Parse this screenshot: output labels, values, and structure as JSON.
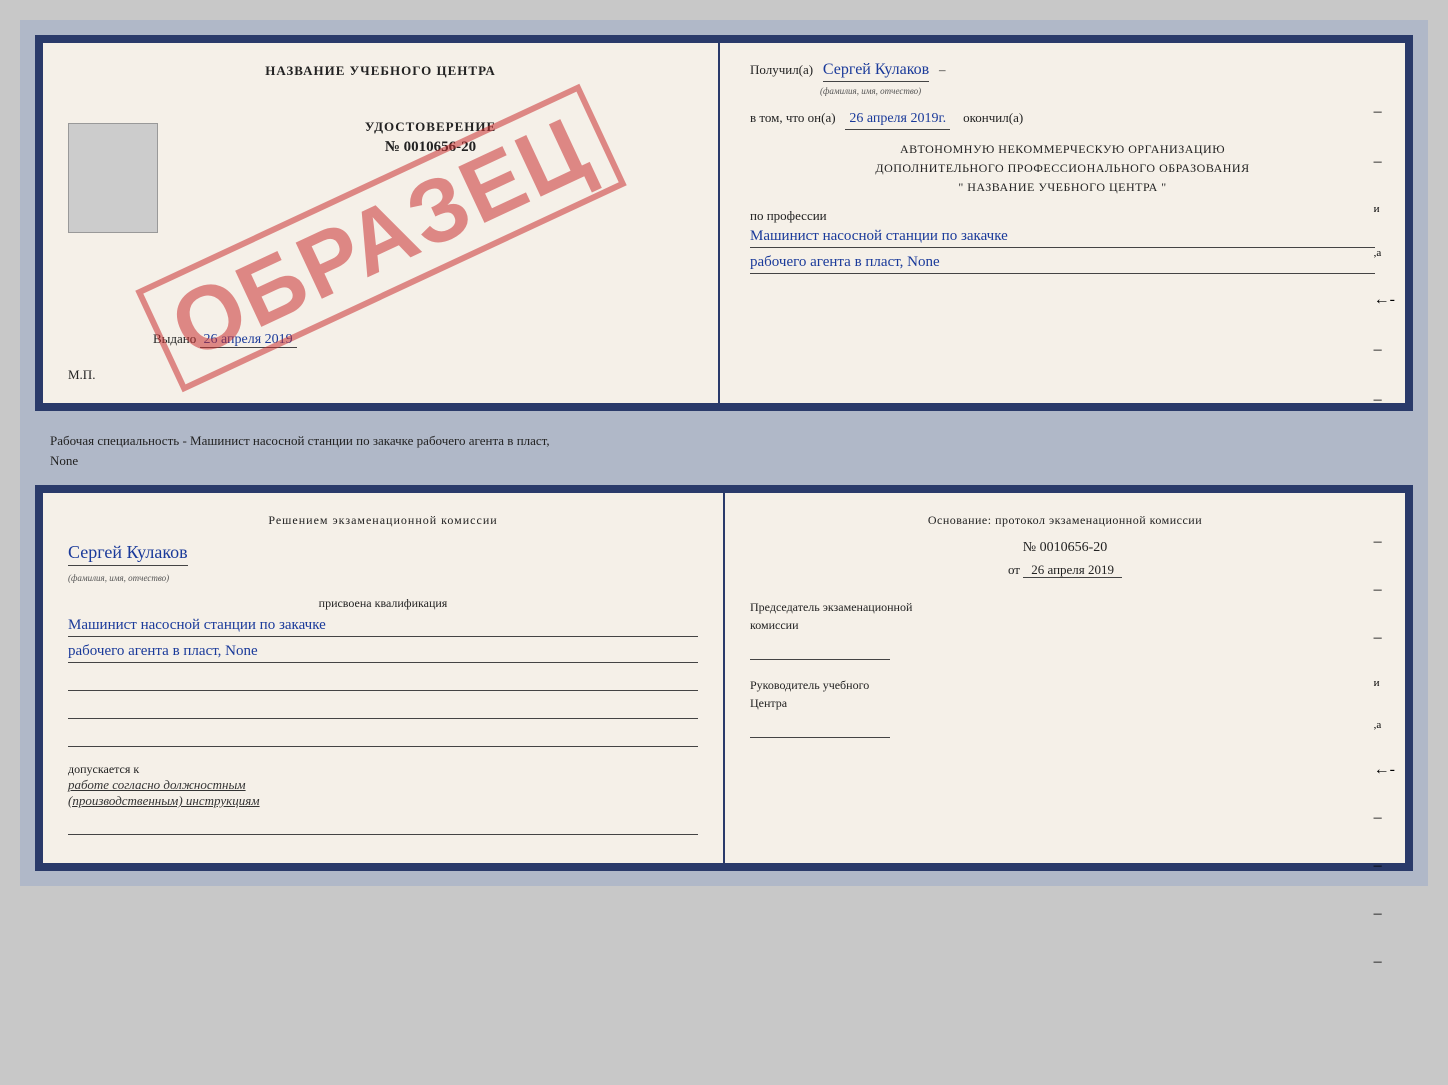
{
  "diploma": {
    "left": {
      "title": "НАЗВАНИЕ УЧЕБНОГО ЦЕНТРА",
      "photo_alt": "photo",
      "stamp_text": "ОБРАЗЕЦ",
      "udostoverenie_label": "УДОСТОВЕРЕНИЕ",
      "udostoverenie_number": "№ 0010656-20",
      "vydano_label": "Выдано",
      "vydano_date": "26 апреля 2019",
      "mp_label": "М.П."
    },
    "right": {
      "poluchil_label": "Получил(а)",
      "recipient_name": "Сергей Кулаков",
      "familiya_label": "(фамилия, имя, отчество)",
      "vtom_label": "в том, что он(а)",
      "completion_date": "26 апреля 2019г.",
      "okonchil_label": "окончил(а)",
      "org_line1": "АВТОНОМНУЮ НЕКОММЕРЧЕСКУЮ ОРГАНИЗАЦИЮ",
      "org_line2": "ДОПОЛНИТЕЛЬНОГО ПРОФЕССИОНАЛЬНОГО ОБРАЗОВАНИЯ",
      "org_line3": "\"  НАЗВАНИЕ УЧЕБНОГО ЦЕНТРА  \"",
      "po_professii_label": "по профессии",
      "profession_line1": "Машинист насосной станции по закачке",
      "profession_line2": "рабочего агента в пласт, None"
    }
  },
  "middle_text": "Рабочая специальность - Машинист насосной станции по закачке рабочего агента в пласт,\nNone",
  "bottom": {
    "left": {
      "resheniem_text": "Решением экзаменационной комиссии",
      "name_handwritten": "Сергей Кулаков",
      "familiya_label": "(фамилия, имя, отчество)",
      "prisvoyena_label": "присвоена квалификация",
      "qual_line1": "Машинист насосной станции по закачке",
      "qual_line2": "рабочего агента в пласт, None",
      "dopuskaetsya_label": "допускается к",
      "dopuskaetsya_work": "работе согласно должностным\n(производственным) инструкциям"
    },
    "right": {
      "osnovaniye_label": "Основание: протокол экзаменационной комиссии",
      "number_label": "№ 0010656-20",
      "ot_label": "от",
      "ot_date": "26 апреля 2019",
      "predsedatel_label": "Председатель экзаменационной\nкомиссии",
      "rukovoditel_label": "Руководитель учебного\nЦентра"
    }
  }
}
